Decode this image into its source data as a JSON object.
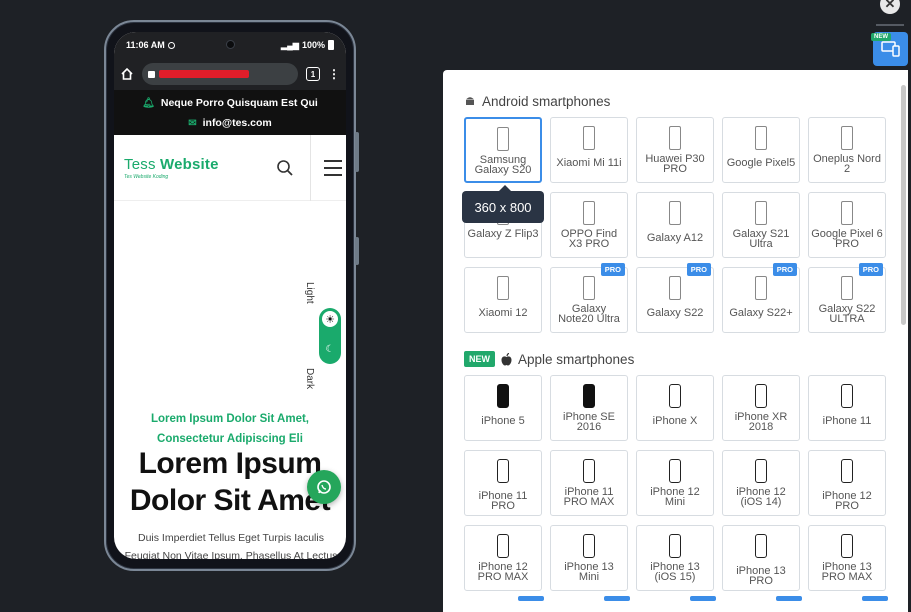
{
  "phone": {
    "status_time": "11:06 AM",
    "status_battery": "100%",
    "tab_count": "1",
    "topbar_line1": "Neque Porro Quisquam Est Qui",
    "topbar_line2": "info@tes.com",
    "logo_light": "Tess ",
    "logo_bold": "Website",
    "logo_tagline": "Tes Website Koding",
    "theme_light": "Light",
    "theme_dark": "Dark",
    "hero_subtitle_1": "Lorem Ipsum Dolor Sit Amet,",
    "hero_subtitle_2": "Consectetur Adipiscing Eli",
    "hero_title_1": "Lorem Ipsum",
    "hero_title_2": "Dolor Sit Amet",
    "hero_body_1": "Duis Imperdiet Tellus Eget Turpis Iaculis",
    "hero_body_2": "Feugiat Non Vitae Ipsum. Phasellus At Lectus"
  },
  "rail": {
    "close_glyph": "✕",
    "new_badge": "NEW"
  },
  "tooltip": "360 x 800",
  "android": {
    "title": "Android smartphones",
    "devices": [
      {
        "name": "Samsung Galaxy S20",
        "pro": false,
        "selected": true
      },
      {
        "name": "Xiaomi Mi 11i",
        "pro": false
      },
      {
        "name": "Huawei P30 PRO",
        "pro": false
      },
      {
        "name": "Google Pixel5",
        "pro": false
      },
      {
        "name": "Oneplus Nord 2",
        "pro": false
      },
      {
        "name": "Galaxy Z Flip3",
        "pro": false
      },
      {
        "name": "OPPO Find X3 PRO",
        "pro": false
      },
      {
        "name": "Galaxy A12",
        "pro": false
      },
      {
        "name": "Galaxy S21 Ultra",
        "pro": false
      },
      {
        "name": "Google Pixel 6 PRO",
        "pro": false
      },
      {
        "name": "Xiaomi 12",
        "pro": false
      },
      {
        "name": "Galaxy Note20 Ultra",
        "pro": true
      },
      {
        "name": "Galaxy S22",
        "pro": true
      },
      {
        "name": "Galaxy S22+",
        "pro": true
      },
      {
        "name": "Galaxy S22 ULTRA",
        "pro": true
      }
    ]
  },
  "apple": {
    "badge": "NEW",
    "title": "Apple smartphones",
    "devices": [
      {
        "name": "iPhone 5",
        "filled": true
      },
      {
        "name": "iPhone SE 2016",
        "filled": true
      },
      {
        "name": "iPhone X"
      },
      {
        "name": "iPhone XR 2018"
      },
      {
        "name": "iPhone 11"
      },
      {
        "name": "iPhone 11 PRO"
      },
      {
        "name": "iPhone 11 PRO MAX"
      },
      {
        "name": "iPhone 12 Mini"
      },
      {
        "name": "iPhone 12 (iOS 14)"
      },
      {
        "name": "iPhone 12 PRO"
      },
      {
        "name": "iPhone 12 PRO MAX"
      },
      {
        "name": "iPhone 13 Mini"
      },
      {
        "name": "iPhone 13 (iOS 15)"
      },
      {
        "name": "iPhone 13 PRO"
      },
      {
        "name": "iPhone 13 PRO MAX"
      }
    ]
  },
  "pro_label": "PRO",
  "colors": {
    "accent": "#3b8de8",
    "brand_green": "#1aaa6c",
    "new_green": "#21a86b"
  }
}
